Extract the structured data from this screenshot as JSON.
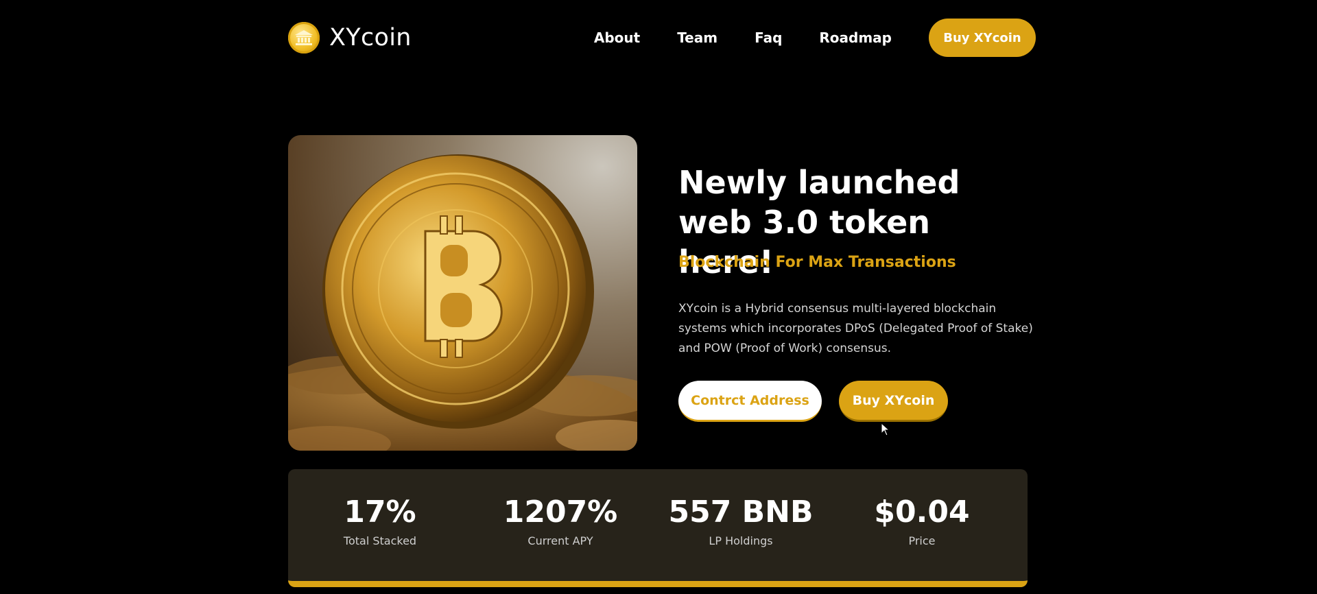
{
  "brand": {
    "name": "XYcoin",
    "icon": "bank-coin-icon"
  },
  "nav": {
    "items": [
      {
        "label": "About"
      },
      {
        "label": "Team"
      },
      {
        "label": "Faq"
      },
      {
        "label": "Roadmap"
      }
    ],
    "buy_label": "Buy XYcoin"
  },
  "hero": {
    "title": "Newly launched web 3.0 token here!",
    "subtitle": "Blockchain For Max Transactions",
    "description": "XYcoin is a Hybrid consensus multi-layered blockchain systems which incorporates DPoS (Delegated Proof of Stake) and POW (Proof of Work) consensus.",
    "contract_label": "Contrct Address",
    "buy_label": "Buy XYcoin",
    "image": "bitcoin-coin-photo"
  },
  "stats": [
    {
      "value": "17%",
      "label": "Total Stacked"
    },
    {
      "value": "1207%",
      "label": "Current APY"
    },
    {
      "value": "557 BNB",
      "label": "LP Holdings"
    },
    {
      "value": "$0.04",
      "label": "Price"
    }
  ],
  "colors": {
    "accent": "#dba314",
    "background": "#000000",
    "stats_panel": "#27231a"
  }
}
